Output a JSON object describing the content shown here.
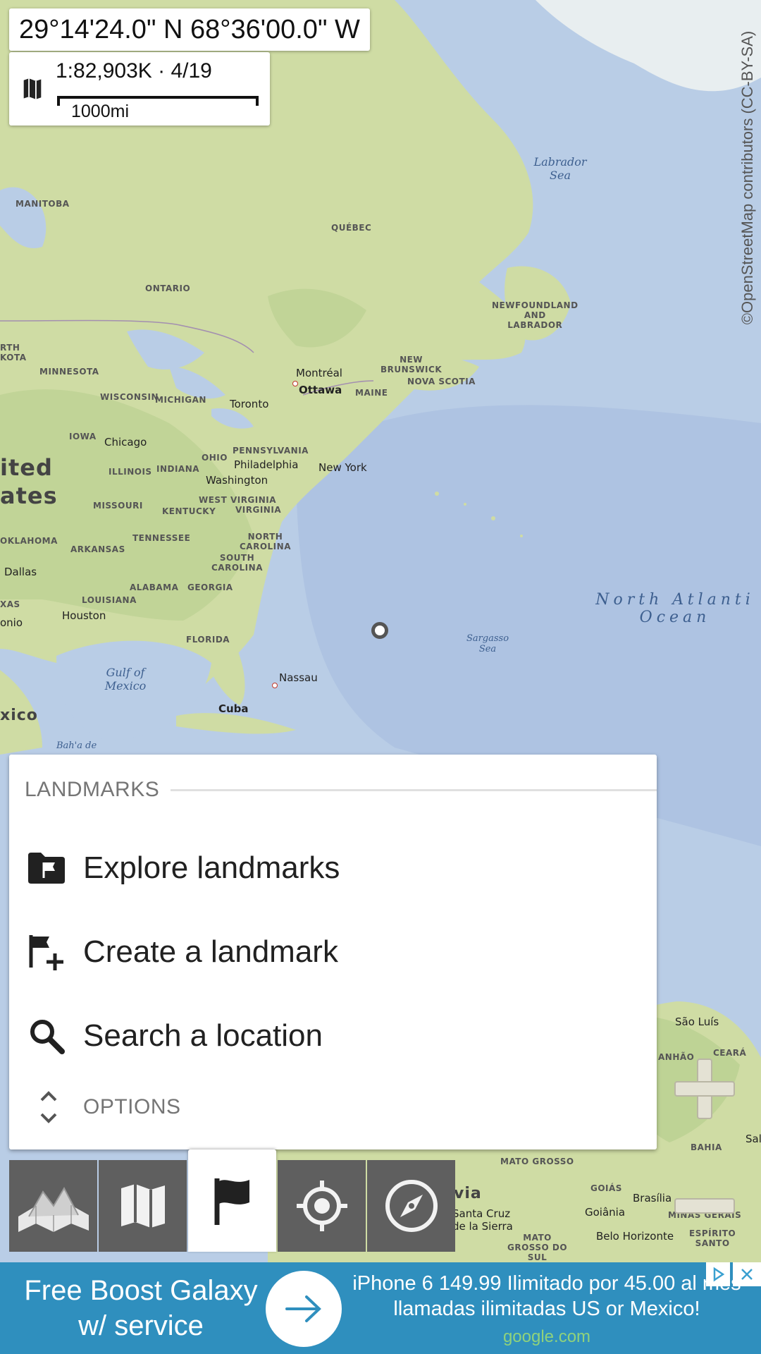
{
  "map": {
    "coordinates": "29°14'24.0\" N 68°36'00.0\" W",
    "scale_text": "1:82,903K · 4/19",
    "scale_distance": "1000mi",
    "attribution": "©OpenStreetMap contributors (CC-BY-SA)",
    "labels": {
      "manitoba": "MANITOBA",
      "quebec": "QUÉBEC",
      "ontario": "ONTARIO",
      "labrador_sea_1": "Labrador",
      "labrador_sea_2": "Sea",
      "newfoundland_1": "NEWFOUNDLAND",
      "newfoundland_2": "AND",
      "newfoundland_3": "LABRADOR",
      "dakota": "RTH\nKOTA",
      "minnesota": "MINNESOTA",
      "montreal": "Montréal",
      "ottawa": "Ottawa",
      "maine": "MAINE",
      "new_brunswick_1": "NEW",
      "new_brunswick_2": "BRUNSWICK",
      "nova_scotia": "NOVA SCOTIA",
      "wisconsin": "WISCONSIN",
      "michigan": "MICHIGAN",
      "toronto": "Toronto",
      "iowa": "IOWA",
      "chicago": "Chicago",
      "ohio": "OHIO",
      "pennsylvania": "PENNSYLVANIA",
      "philadelphia": "Philadelphia",
      "new_york": "New York",
      "united": "ited",
      "states": "ates",
      "illinois": "ILLINOIS",
      "indiana": "INDIANA",
      "washington": "Washington",
      "missouri": "MISSOURI",
      "west_virginia": "WEST VIRGINIA",
      "kentucky": "KENTUCKY",
      "virginia": "VIRGINIA",
      "oklahoma": "OKLAHOMA",
      "tennessee": "TENNESSEE",
      "north_carolina_1": "NORTH",
      "north_carolina_2": "CAROLINA",
      "arkansas": "ARKANSAS",
      "south_carolina_1": "SOUTH",
      "south_carolina_2": "CAROLINA",
      "dallas": "Dallas",
      "alabama": "ALABAMA",
      "georgia": "GEORGIA",
      "louisiana": "LOUISIANA",
      "xas": "XAS",
      "houston": "Houston",
      "onio": "onio",
      "florida": "FLORIDA",
      "north_atlantic_1": "North Atlanti",
      "north_atlantic_2": "Ocean",
      "sargasso_1": "Sargasso",
      "sargasso_2": "Sea",
      "gulf_1": "Gulf of",
      "gulf_2": "Mexico",
      "nassau": "Nassau",
      "cuba": "Cuba",
      "xico": "xico",
      "bahia_de": "Bah'a de",
      "sao_luis": "São Luís",
      "ceara": "CEARÁ",
      "anhao": "ANHÃO",
      "bahia": "BAHIA",
      "sal": "Sal",
      "mato_grosso": "MATO GROSSO",
      "via": "via",
      "santa_cruz_1": "Santa Cruz",
      "santa_cruz_2": "de la Sierra",
      "goias": "GOIÁS",
      "brasilia": "Brasília",
      "goiania": "Goiânia",
      "minas_gerais": "MINAS GERAIS",
      "espirito_1": "ESPÍRITO",
      "espirito_2": "SANTO",
      "belo_horizonte": "Belo Horizonte",
      "mato_grosso_sul_1": "MATO",
      "mato_grosso_sul_2": "GROSSO DO",
      "mato_grosso_sul_3": "SUL"
    }
  },
  "panel": {
    "title": "LANDMARKS",
    "items": [
      {
        "label": "Explore landmarks",
        "icon": "folder-flag-icon"
      },
      {
        "label": "Create a landmark",
        "icon": "flag-plus-icon"
      },
      {
        "label": "Search a location",
        "icon": "search-icon"
      }
    ],
    "options_label": "OPTIONS"
  },
  "toolbar": {
    "buttons": [
      {
        "name": "terrain-map-icon",
        "active": false
      },
      {
        "name": "map-icon",
        "active": false
      },
      {
        "name": "flag-icon",
        "active": true
      },
      {
        "name": "gps-target-icon",
        "active": false
      },
      {
        "name": "compass-icon",
        "active": false
      }
    ]
  },
  "ad": {
    "left_line1": "Free Boost Galaxy",
    "left_line2": "w/ service",
    "headline": "iPhone 6 149.99 Ilimitado por 45.00 al mes llamadas ilimitadas US or Mexico!",
    "source": "google.com"
  },
  "colors": {
    "land": "#cfdca4",
    "water": "#b9cde6",
    "toolbar": "#5f5f5f",
    "ad_bg": "#2f8fbe"
  }
}
